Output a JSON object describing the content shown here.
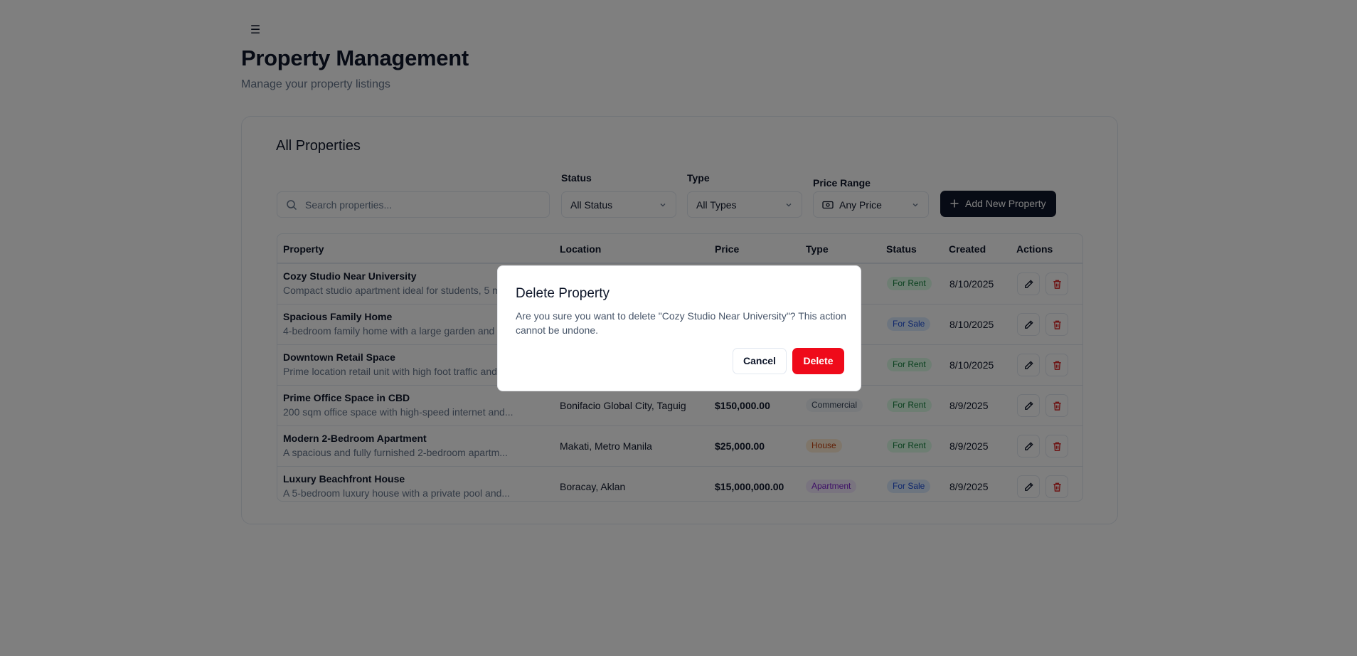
{
  "header": {
    "title": "Property Management",
    "subtitle": "Manage your property listings"
  },
  "card": {
    "title": "All Properties"
  },
  "filters": {
    "search_placeholder": "Search properties...",
    "status_label": "Status",
    "status_value": "All Status",
    "type_label": "Type",
    "type_value": "All Types",
    "price_label": "Price Range",
    "price_value": "Any Price",
    "add_button": "Add New Property"
  },
  "table": {
    "columns": [
      "Property",
      "Location",
      "Price",
      "Type",
      "Status",
      "Created",
      "Actions"
    ],
    "rows": [
      {
        "name": "Cozy Studio Near University",
        "desc": "Compact studio apartment ideal for students, 5 m",
        "location": "",
        "price": "",
        "type": "",
        "status": "For Rent",
        "created": "8/10/2025"
      },
      {
        "name": "Spacious Family Home",
        "desc": "4-bedroom family home with a large garden and",
        "location": "",
        "price": "",
        "type": "",
        "status": "For Sale",
        "created": "8/10/2025"
      },
      {
        "name": "Downtown Retail Space",
        "desc": "Prime location retail unit with high foot traffic and",
        "location": "",
        "price": "",
        "type": "",
        "status": "For Rent",
        "created": "8/10/2025"
      },
      {
        "name": "Prime Office Space in CBD",
        "desc": "200 sqm office space with high-speed internet and...",
        "location": "Bonifacio Global City, Taguig",
        "price": "$150,000.00",
        "type": "Commercial",
        "status": "For Rent",
        "created": "8/9/2025"
      },
      {
        "name": "Modern 2-Bedroom Apartment",
        "desc": "A spacious and fully furnished 2-bedroom apartm...",
        "location": "Makati, Metro Manila",
        "price": "$25,000.00",
        "type": "House",
        "status": "For Rent",
        "created": "8/9/2025"
      },
      {
        "name": "Luxury Beachfront House",
        "desc": "A 5-bedroom luxury house with a private pool and...",
        "location": "Boracay, Aklan",
        "price": "$15,000,000.00",
        "type": "Apartment",
        "status": "For Sale",
        "created": "8/9/2025"
      }
    ]
  },
  "modal": {
    "title": "Delete Property",
    "message": "Are you sure you want to delete \"Cozy Studio Near University\"? This action cannot be undone.",
    "cancel": "Cancel",
    "delete": "Delete"
  },
  "colors": {
    "primary": "#0f172a",
    "danger": "#ef0a1a",
    "for_rent_bg": "#dcfce7",
    "for_rent_fg": "#15803d",
    "for_sale_bg": "#dbeafe",
    "for_sale_fg": "#1d4ed8",
    "commercial_bg": "#f1f5f9",
    "house_bg": "#ffedd5",
    "apartment_bg": "#f3e8ff"
  },
  "icons": {
    "menu": "menu-icon",
    "search": "search-icon",
    "chevron": "chevron-down-icon",
    "price": "banknote-icon",
    "add": "plus-icon",
    "edit": "pencil-icon",
    "delete": "trash-icon"
  }
}
